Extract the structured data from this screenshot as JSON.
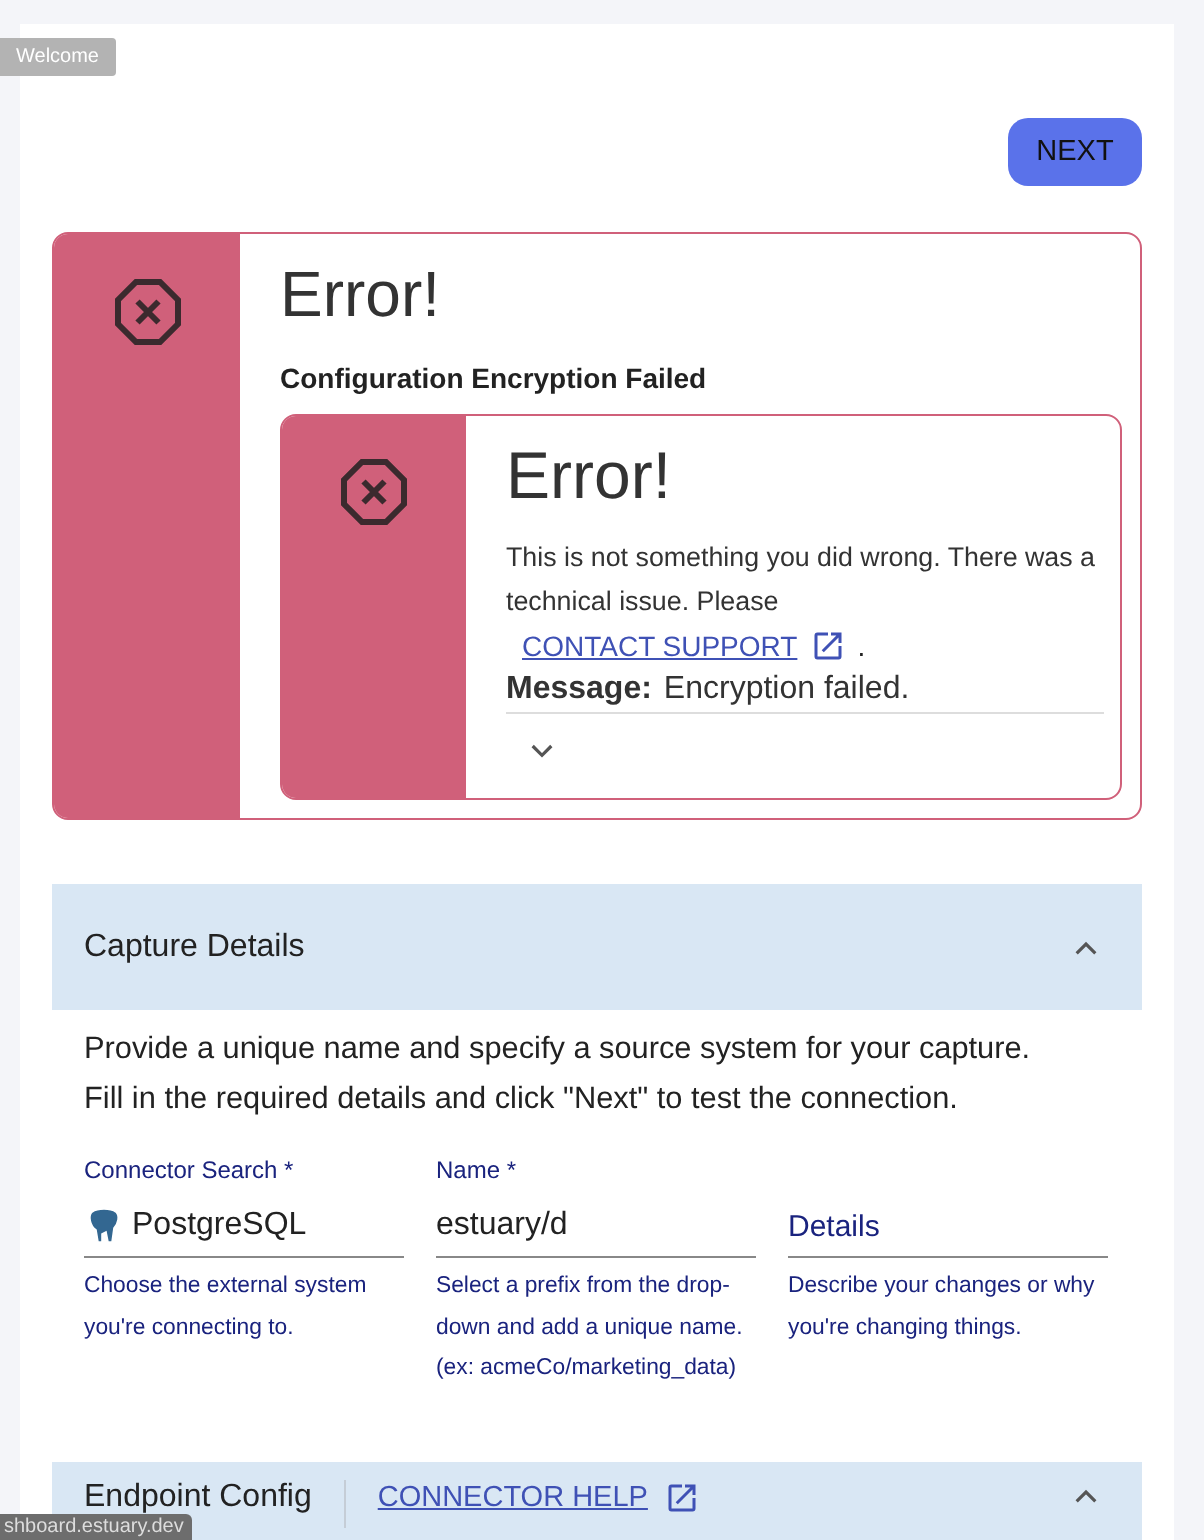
{
  "tooltip": {
    "text": "Welcome"
  },
  "actions": {
    "next_button": "NEXT"
  },
  "error": {
    "title": "Error!",
    "subtitle": "Configuration Encryption Failed",
    "inner": {
      "title": "Error!",
      "body": "This is not something you did wrong. There was a technical issue. Please",
      "link": "CONTACT SUPPORT",
      "after_link": ".",
      "message_label": "Message:",
      "message": "Encryption failed.",
      "expanded": false
    }
  },
  "capture_details": {
    "title": "Capture Details",
    "expanded": true,
    "intro": "Provide a unique name and specify a source system for your capture.\nFill in the required details and click \"Next\" to test the connection.",
    "fields": [
      {
        "kind": "connector",
        "label": "Connector Search *",
        "value": "PostgreSQL",
        "helper": "Choose the external system you're connecting to."
      },
      {
        "kind": "text",
        "label": "Name *",
        "value": "estuary/d",
        "helper": "Select a prefix from the drop-down and add a unique name. (ex: acmeCo/marketing_data)"
      },
      {
        "kind": "text",
        "placeholder": "Details",
        "helper": "Describe your changes or why you're changing things."
      }
    ]
  },
  "endpoint_config": {
    "title": "Endpoint Config",
    "link": "CONNECTOR HELP",
    "expanded": true
  },
  "status_bar": {
    "url": "shboard.estuary.dev"
  }
}
